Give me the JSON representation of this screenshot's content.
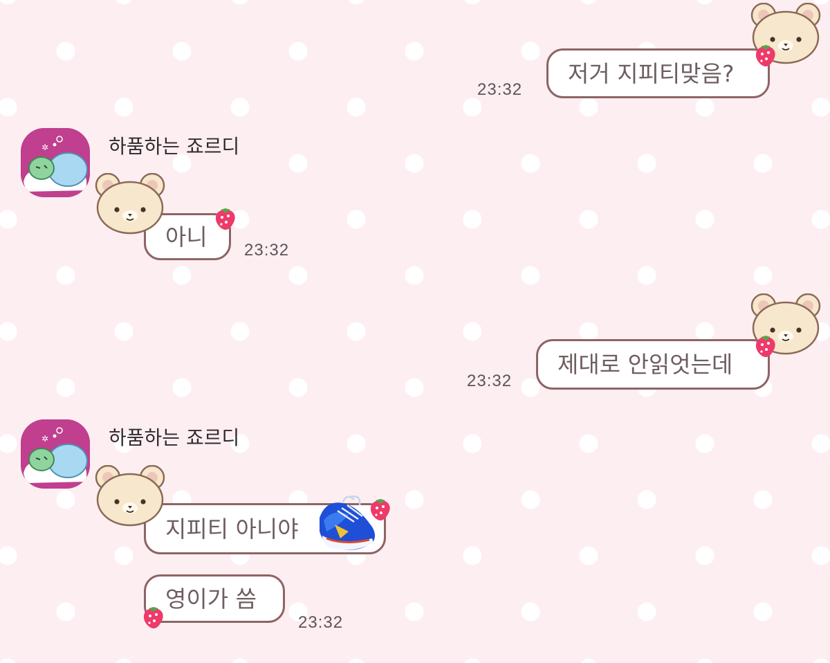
{
  "chat": {
    "sender_name": "하품하는 죠르디",
    "messages": [
      {
        "side": "out",
        "text": "저거 지피티맞음?",
        "time": "23:32"
      },
      {
        "side": "in",
        "text": "아니",
        "time": "23:32"
      },
      {
        "side": "out",
        "text": "제대로 안읽엇는데",
        "time": "23:32"
      },
      {
        "side": "in",
        "text": "지피티 아니야",
        "time": ""
      },
      {
        "side": "in",
        "text": "영이가 씀",
        "time": "23:32"
      }
    ]
  },
  "colors": {
    "background": "#fdeef2",
    "bubble_border": "#8d6464",
    "bubble_text": "#6e5d60",
    "avatar_bg": "#c03f8e",
    "berry": "#ee3a6a"
  },
  "icons": {
    "bubble_bear": "bear-face-icon",
    "bubble_corner": "strawberry-icon",
    "avatar": "sleeping-jordy-avatar",
    "sticker": "sneaker-sticker"
  }
}
